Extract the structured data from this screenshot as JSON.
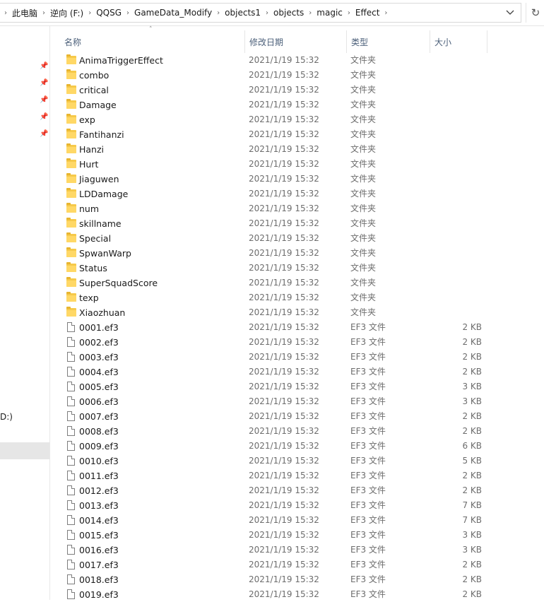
{
  "address": {
    "crumbs": [
      "此电脑",
      "逆向 (F:)",
      "QQSG",
      "GameData_Modify",
      "objects1",
      "objects",
      "magic",
      "Effect"
    ],
    "dropdown_icon": "chevron-down-icon",
    "refresh_icon": "refresh-icon"
  },
  "nav": {
    "drive_label": "D:)"
  },
  "columns": {
    "name": "名称",
    "date": "修改日期",
    "type": "类型",
    "size": "大小"
  },
  "files": [
    {
      "name": "AnimaTriggerEffect",
      "date": "2021/1/19 15:32",
      "type": "文件夹",
      "size": "",
      "kind": "folder"
    },
    {
      "name": "combo",
      "date": "2021/1/19 15:32",
      "type": "文件夹",
      "size": "",
      "kind": "folder"
    },
    {
      "name": "critical",
      "date": "2021/1/19 15:32",
      "type": "文件夹",
      "size": "",
      "kind": "folder"
    },
    {
      "name": "Damage",
      "date": "2021/1/19 15:32",
      "type": "文件夹",
      "size": "",
      "kind": "folder"
    },
    {
      "name": "exp",
      "date": "2021/1/19 15:32",
      "type": "文件夹",
      "size": "",
      "kind": "folder"
    },
    {
      "name": "Fantihanzi",
      "date": "2021/1/19 15:32",
      "type": "文件夹",
      "size": "",
      "kind": "folder"
    },
    {
      "name": "Hanzi",
      "date": "2021/1/19 15:32",
      "type": "文件夹",
      "size": "",
      "kind": "folder"
    },
    {
      "name": "Hurt",
      "date": "2021/1/19 15:32",
      "type": "文件夹",
      "size": "",
      "kind": "folder"
    },
    {
      "name": "Jiaguwen",
      "date": "2021/1/19 15:32",
      "type": "文件夹",
      "size": "",
      "kind": "folder"
    },
    {
      "name": "LDDamage",
      "date": "2021/1/19 15:32",
      "type": "文件夹",
      "size": "",
      "kind": "folder"
    },
    {
      "name": "num",
      "date": "2021/1/19 15:32",
      "type": "文件夹",
      "size": "",
      "kind": "folder"
    },
    {
      "name": "skillname",
      "date": "2021/1/19 15:32",
      "type": "文件夹",
      "size": "",
      "kind": "folder"
    },
    {
      "name": "Special",
      "date": "2021/1/19 15:32",
      "type": "文件夹",
      "size": "",
      "kind": "folder"
    },
    {
      "name": "SpwanWarp",
      "date": "2021/1/19 15:32",
      "type": "文件夹",
      "size": "",
      "kind": "folder"
    },
    {
      "name": "Status",
      "date": "2021/1/19 15:32",
      "type": "文件夹",
      "size": "",
      "kind": "folder"
    },
    {
      "name": "SuperSquadScore",
      "date": "2021/1/19 15:32",
      "type": "文件夹",
      "size": "",
      "kind": "folder"
    },
    {
      "name": "texp",
      "date": "2021/1/19 15:32",
      "type": "文件夹",
      "size": "",
      "kind": "folder"
    },
    {
      "name": "Xiaozhuan",
      "date": "2021/1/19 15:32",
      "type": "文件夹",
      "size": "",
      "kind": "folder"
    },
    {
      "name": "0001.ef3",
      "date": "2021/1/19 15:32",
      "type": "EF3 文件",
      "size": "2 KB",
      "kind": "file"
    },
    {
      "name": "0002.ef3",
      "date": "2021/1/19 15:32",
      "type": "EF3 文件",
      "size": "2 KB",
      "kind": "file"
    },
    {
      "name": "0003.ef3",
      "date": "2021/1/19 15:32",
      "type": "EF3 文件",
      "size": "2 KB",
      "kind": "file"
    },
    {
      "name": "0004.ef3",
      "date": "2021/1/19 15:32",
      "type": "EF3 文件",
      "size": "2 KB",
      "kind": "file"
    },
    {
      "name": "0005.ef3",
      "date": "2021/1/19 15:32",
      "type": "EF3 文件",
      "size": "3 KB",
      "kind": "file"
    },
    {
      "name": "0006.ef3",
      "date": "2021/1/19 15:32",
      "type": "EF3 文件",
      "size": "3 KB",
      "kind": "file"
    },
    {
      "name": "0007.ef3",
      "date": "2021/1/19 15:32",
      "type": "EF3 文件",
      "size": "2 KB",
      "kind": "file"
    },
    {
      "name": "0008.ef3",
      "date": "2021/1/19 15:32",
      "type": "EF3 文件",
      "size": "2 KB",
      "kind": "file"
    },
    {
      "name": "0009.ef3",
      "date": "2021/1/19 15:32",
      "type": "EF3 文件",
      "size": "6 KB",
      "kind": "file"
    },
    {
      "name": "0010.ef3",
      "date": "2021/1/19 15:32",
      "type": "EF3 文件",
      "size": "5 KB",
      "kind": "file"
    },
    {
      "name": "0011.ef3",
      "date": "2021/1/19 15:32",
      "type": "EF3 文件",
      "size": "2 KB",
      "kind": "file"
    },
    {
      "name": "0012.ef3",
      "date": "2021/1/19 15:32",
      "type": "EF3 文件",
      "size": "2 KB",
      "kind": "file"
    },
    {
      "name": "0013.ef3",
      "date": "2021/1/19 15:32",
      "type": "EF3 文件",
      "size": "7 KB",
      "kind": "file"
    },
    {
      "name": "0014.ef3",
      "date": "2021/1/19 15:32",
      "type": "EF3 文件",
      "size": "7 KB",
      "kind": "file"
    },
    {
      "name": "0015.ef3",
      "date": "2021/1/19 15:32",
      "type": "EF3 文件",
      "size": "3 KB",
      "kind": "file"
    },
    {
      "name": "0016.ef3",
      "date": "2021/1/19 15:32",
      "type": "EF3 文件",
      "size": "3 KB",
      "kind": "file"
    },
    {
      "name": "0017.ef3",
      "date": "2021/1/19 15:32",
      "type": "EF3 文件",
      "size": "2 KB",
      "kind": "file"
    },
    {
      "name": "0018.ef3",
      "date": "2021/1/19 15:32",
      "type": "EF3 文件",
      "size": "2 KB",
      "kind": "file"
    },
    {
      "name": "0019.ef3",
      "date": "2021/1/19 15:32",
      "type": "EF3 文件",
      "size": "2 KB",
      "kind": "file"
    }
  ]
}
